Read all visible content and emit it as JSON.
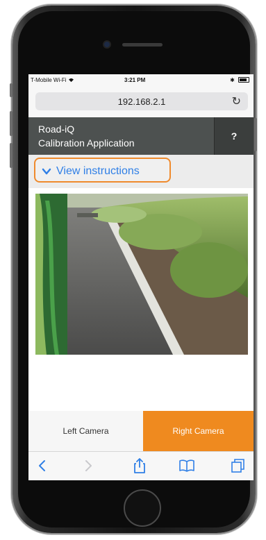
{
  "status_bar": {
    "carrier": "T-Mobile Wi-Fi",
    "time": "3:21 PM",
    "bluetooth": "✱"
  },
  "browser": {
    "url": "192.168.2.1",
    "reload_icon": "↻"
  },
  "app": {
    "title_line1": "Road-iQ",
    "title_line2": "Calibration Application",
    "help_label": "?"
  },
  "instructions": {
    "label": "View instructions",
    "chevron": "❯"
  },
  "camera_buttons": {
    "left": "Left Camera",
    "right": "Right Camera",
    "selected": "right"
  },
  "toolbar": {
    "icons": [
      "back-icon",
      "forward-icon",
      "share-icon",
      "bookmarks-icon",
      "tabs-icon"
    ]
  },
  "colors": {
    "accent_orange": "#ef8a1f",
    "link_blue": "#2f7fe6",
    "header_gray": "#4d5150"
  }
}
